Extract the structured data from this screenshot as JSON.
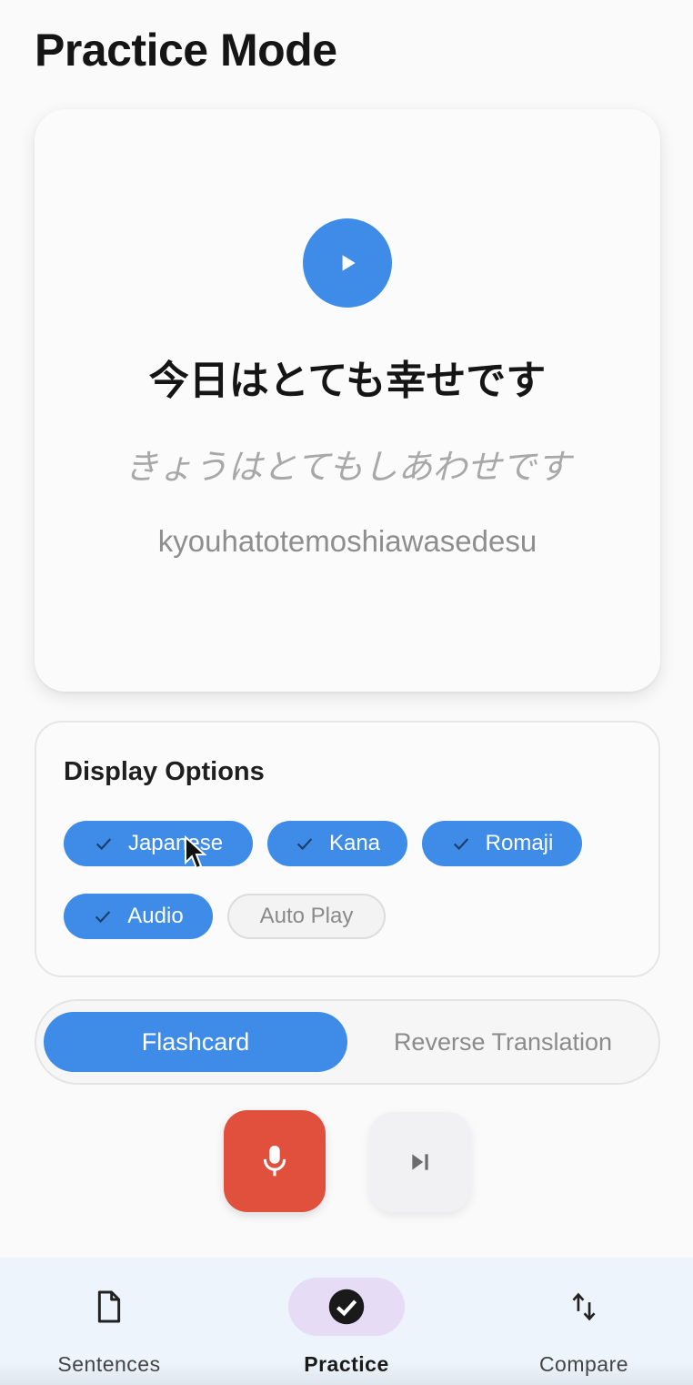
{
  "header": {
    "title": "Practice Mode"
  },
  "card": {
    "play_icon": "play-icon",
    "japanese": "今日はとても幸せです",
    "kana": "きょうはとてもしあわせです",
    "romaji": "kyouhatotemoshiawasedesu"
  },
  "display_options": {
    "title": "Display Options",
    "chips": [
      {
        "label": "Japanese",
        "selected": true
      },
      {
        "label": "Kana",
        "selected": true
      },
      {
        "label": "Romaji",
        "selected": true
      },
      {
        "label": "Audio",
        "selected": true
      },
      {
        "label": "Auto Play",
        "selected": false
      }
    ]
  },
  "mode": {
    "options": [
      "Flashcard",
      "Reverse Translation"
    ],
    "selected": "Flashcard"
  },
  "actions": {
    "record_icon": "microphone-icon",
    "skip_icon": "skip-next-icon"
  },
  "bottom_nav": {
    "items": [
      {
        "label": "Sentences",
        "icon": "document-icon",
        "active": false
      },
      {
        "label": "Practice",
        "icon": "check-circle-icon",
        "active": true
      },
      {
        "label": "Compare",
        "icon": "swap-vertical-icon",
        "active": false
      }
    ]
  },
  "colors": {
    "accent": "#3f8ce8",
    "record": "#e0503d",
    "nav_active_pill": "#e6dcf5",
    "nav_background": "#eef4fb"
  }
}
